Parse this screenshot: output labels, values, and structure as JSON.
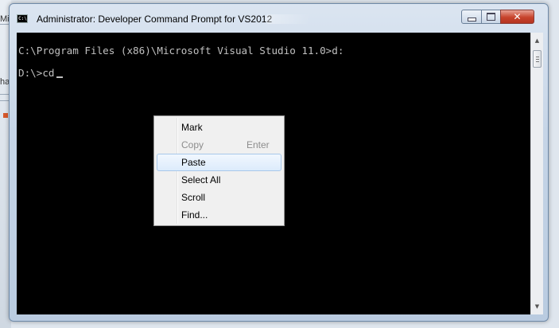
{
  "background": {
    "left_texts": [
      "Mic",
      "ha"
    ]
  },
  "window": {
    "title": "Administrator: Developer Command Prompt for VS2012",
    "icon": "cmd-icon",
    "buttons": {
      "minimize": "minimize-icon",
      "maximize": "maximize-icon",
      "close_glyph": "✕"
    }
  },
  "console": {
    "line1": "C:\\Program Files (x86)\\Microsoft Visual Studio 11.0>d:",
    "line2": "D:\\>cd"
  },
  "scrollbar": {
    "up_arrow": "▲",
    "down_arrow": "▼"
  },
  "context_menu": {
    "items": [
      {
        "label": "Mark",
        "shortcut": "",
        "state": "normal"
      },
      {
        "label": "Copy",
        "shortcut": "Enter",
        "state": "disabled"
      },
      {
        "label": "Paste",
        "shortcut": "",
        "state": "highlighted"
      },
      {
        "label": "Select All",
        "shortcut": "",
        "state": "normal"
      },
      {
        "label": "Scroll",
        "shortcut": "",
        "state": "normal"
      },
      {
        "label": "Find...",
        "shortcut": "",
        "state": "normal"
      }
    ]
  },
  "colors": {
    "console_bg": "#000000",
    "console_fg": "#c0c0c0",
    "close_button": "#c7432c",
    "menu_highlight": "#dcebfc"
  }
}
